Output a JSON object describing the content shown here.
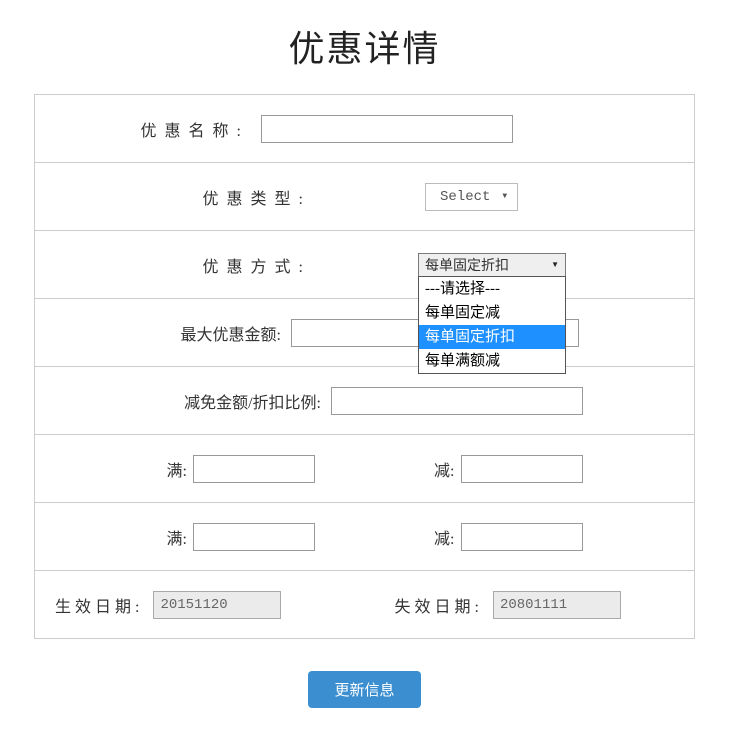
{
  "title": "优惠详情",
  "labels": {
    "name": "优惠名称:",
    "type": "优惠类型:",
    "method": "优惠方式:",
    "maxAmount": "最大优惠金额:",
    "discountRatio": "减免金额/折扣比例:",
    "full": "满:",
    "reduce": "减:",
    "effective": "生效日期:",
    "expire": "失效日期:"
  },
  "values": {
    "name": "",
    "typeSelected": "Select",
    "methodSelected": "每单固定折扣",
    "maxAmount": "",
    "discountRatio": "",
    "full1": "",
    "reduce1": "",
    "full2": "",
    "reduce2": "",
    "effectiveDate": "20151120",
    "expireDate": "20801111"
  },
  "methodOptions": {
    "placeholder": "---请选择---",
    "opt1": "每单固定减",
    "opt2": "每单固定折扣",
    "opt3": "每单满额减"
  },
  "button": {
    "submit": "更新信息"
  }
}
